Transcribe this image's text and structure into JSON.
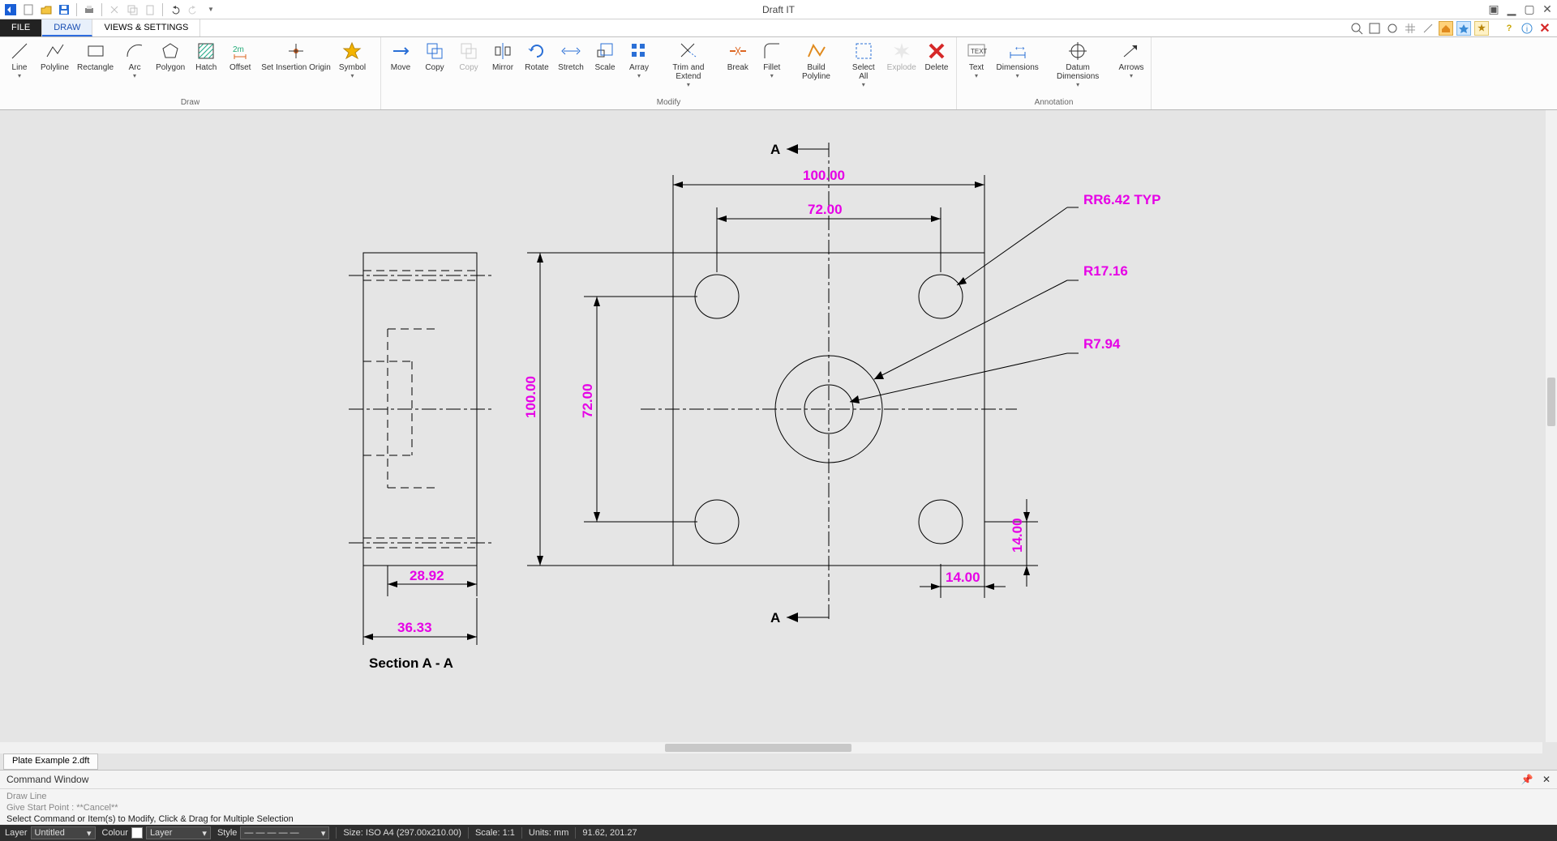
{
  "app_title": "Draft IT",
  "tabs": {
    "file": "FILE",
    "draw": "DRAW",
    "views": "VIEWS & SETTINGS"
  },
  "ribbon": {
    "draw_group": "Draw",
    "modify_group": "Modify",
    "anno_group": "Annotation",
    "line": "Line",
    "polyline": "Polyline",
    "rectangle": "Rectangle",
    "arc": "Arc",
    "polygon": "Polygon",
    "hatch": "Hatch",
    "offset": "Offset",
    "set_origin": "Set Insertion Origin",
    "symbol": "Symbol",
    "move": "Move",
    "copy": "Copy",
    "copy2": "Copy",
    "mirror": "Mirror",
    "rotate": "Rotate",
    "stretch": "Stretch",
    "scale": "Scale",
    "array": "Array",
    "trim": "Trim and Extend",
    "break": "Break",
    "fillet": "Fillet",
    "build_poly": "Build Polyline",
    "select_all": "Select All",
    "explode": "Explode",
    "delete": "Delete",
    "text": "Text",
    "dimensions": "Dimensions",
    "datum": "Datum Dimensions",
    "arrows": "Arrows"
  },
  "drawing": {
    "dim_100_top": "100.00",
    "dim_72_top": "72.00",
    "dim_100_left": "100.00",
    "dim_72_left": "72.00",
    "dim_14_b": "14.00",
    "dim_14_r": "14.00",
    "dim_2892": "28.92",
    "dim_3633": "36.33",
    "section_label": "Section A - A",
    "rr642": "RR6.42 TYP",
    "r1716": "R17.16",
    "r794": "R7.94",
    "A": "A"
  },
  "doc_tab": "Plate Example 2.dft",
  "cmd": {
    "title": "Command Window",
    "l1": "Draw Line",
    "l2": "Give Start Point :  **Cancel**",
    "l3": "Select Command or Item(s) to Modify, Click & Drag for Multiple Selection"
  },
  "status": {
    "layer_label": "Layer",
    "layer_value": "Untitled",
    "colour_label": "Colour",
    "colour_value": "Layer",
    "style_label": "Style",
    "size": "Size: ISO A4 (297.00x210.00)",
    "scale": "Scale: 1:1",
    "units": "Units: mm",
    "coords": "91.62, 201.27"
  }
}
